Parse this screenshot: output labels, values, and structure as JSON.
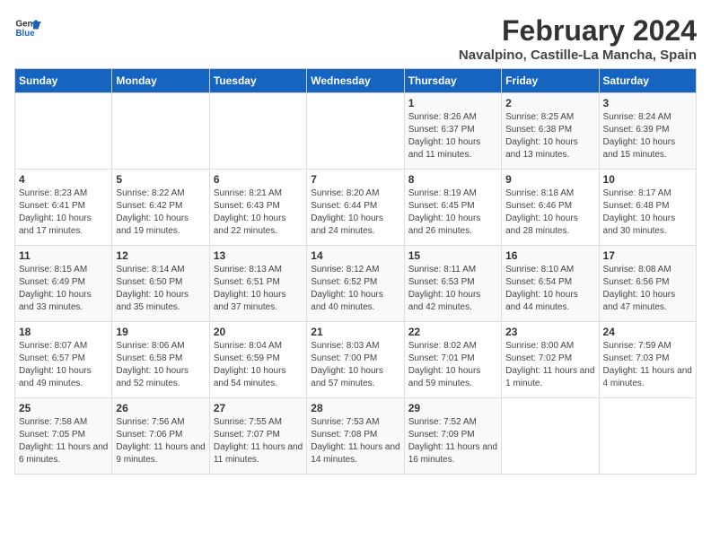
{
  "logo": {
    "line1": "General",
    "line2": "Blue"
  },
  "title": "February 2024",
  "subtitle": "Navalpino, Castille-La Mancha, Spain",
  "weekdays": [
    "Sunday",
    "Monday",
    "Tuesday",
    "Wednesday",
    "Thursday",
    "Friday",
    "Saturday"
  ],
  "weeks": [
    [
      {
        "num": "",
        "detail": ""
      },
      {
        "num": "",
        "detail": ""
      },
      {
        "num": "",
        "detail": ""
      },
      {
        "num": "",
        "detail": ""
      },
      {
        "num": "1",
        "detail": "Sunrise: 8:26 AM\nSunset: 6:37 PM\nDaylight: 10 hours\nand 11 minutes."
      },
      {
        "num": "2",
        "detail": "Sunrise: 8:25 AM\nSunset: 6:38 PM\nDaylight: 10 hours\nand 13 minutes."
      },
      {
        "num": "3",
        "detail": "Sunrise: 8:24 AM\nSunset: 6:39 PM\nDaylight: 10 hours\nand 15 minutes."
      }
    ],
    [
      {
        "num": "4",
        "detail": "Sunrise: 8:23 AM\nSunset: 6:41 PM\nDaylight: 10 hours\nand 17 minutes."
      },
      {
        "num": "5",
        "detail": "Sunrise: 8:22 AM\nSunset: 6:42 PM\nDaylight: 10 hours\nand 19 minutes."
      },
      {
        "num": "6",
        "detail": "Sunrise: 8:21 AM\nSunset: 6:43 PM\nDaylight: 10 hours\nand 22 minutes."
      },
      {
        "num": "7",
        "detail": "Sunrise: 8:20 AM\nSunset: 6:44 PM\nDaylight: 10 hours\nand 24 minutes."
      },
      {
        "num": "8",
        "detail": "Sunrise: 8:19 AM\nSunset: 6:45 PM\nDaylight: 10 hours\nand 26 minutes."
      },
      {
        "num": "9",
        "detail": "Sunrise: 8:18 AM\nSunset: 6:46 PM\nDaylight: 10 hours\nand 28 minutes."
      },
      {
        "num": "10",
        "detail": "Sunrise: 8:17 AM\nSunset: 6:48 PM\nDaylight: 10 hours\nand 30 minutes."
      }
    ],
    [
      {
        "num": "11",
        "detail": "Sunrise: 8:15 AM\nSunset: 6:49 PM\nDaylight: 10 hours\nand 33 minutes."
      },
      {
        "num": "12",
        "detail": "Sunrise: 8:14 AM\nSunset: 6:50 PM\nDaylight: 10 hours\nand 35 minutes."
      },
      {
        "num": "13",
        "detail": "Sunrise: 8:13 AM\nSunset: 6:51 PM\nDaylight: 10 hours\nand 37 minutes."
      },
      {
        "num": "14",
        "detail": "Sunrise: 8:12 AM\nSunset: 6:52 PM\nDaylight: 10 hours\nand 40 minutes."
      },
      {
        "num": "15",
        "detail": "Sunrise: 8:11 AM\nSunset: 6:53 PM\nDaylight: 10 hours\nand 42 minutes."
      },
      {
        "num": "16",
        "detail": "Sunrise: 8:10 AM\nSunset: 6:54 PM\nDaylight: 10 hours\nand 44 minutes."
      },
      {
        "num": "17",
        "detail": "Sunrise: 8:08 AM\nSunset: 6:56 PM\nDaylight: 10 hours\nand 47 minutes."
      }
    ],
    [
      {
        "num": "18",
        "detail": "Sunrise: 8:07 AM\nSunset: 6:57 PM\nDaylight: 10 hours\nand 49 minutes."
      },
      {
        "num": "19",
        "detail": "Sunrise: 8:06 AM\nSunset: 6:58 PM\nDaylight: 10 hours\nand 52 minutes."
      },
      {
        "num": "20",
        "detail": "Sunrise: 8:04 AM\nSunset: 6:59 PM\nDaylight: 10 hours\nand 54 minutes."
      },
      {
        "num": "21",
        "detail": "Sunrise: 8:03 AM\nSunset: 7:00 PM\nDaylight: 10 hours\nand 57 minutes."
      },
      {
        "num": "22",
        "detail": "Sunrise: 8:02 AM\nSunset: 7:01 PM\nDaylight: 10 hours\nand 59 minutes."
      },
      {
        "num": "23",
        "detail": "Sunrise: 8:00 AM\nSunset: 7:02 PM\nDaylight: 11 hours\nand 1 minute."
      },
      {
        "num": "24",
        "detail": "Sunrise: 7:59 AM\nSunset: 7:03 PM\nDaylight: 11 hours\nand 4 minutes."
      }
    ],
    [
      {
        "num": "25",
        "detail": "Sunrise: 7:58 AM\nSunset: 7:05 PM\nDaylight: 11 hours\nand 6 minutes."
      },
      {
        "num": "26",
        "detail": "Sunrise: 7:56 AM\nSunset: 7:06 PM\nDaylight: 11 hours\nand 9 minutes."
      },
      {
        "num": "27",
        "detail": "Sunrise: 7:55 AM\nSunset: 7:07 PM\nDaylight: 11 hours\nand 11 minutes."
      },
      {
        "num": "28",
        "detail": "Sunrise: 7:53 AM\nSunset: 7:08 PM\nDaylight: 11 hours\nand 14 minutes."
      },
      {
        "num": "29",
        "detail": "Sunrise: 7:52 AM\nSunset: 7:09 PM\nDaylight: 11 hours\nand 16 minutes."
      },
      {
        "num": "",
        "detail": ""
      },
      {
        "num": "",
        "detail": ""
      }
    ]
  ]
}
